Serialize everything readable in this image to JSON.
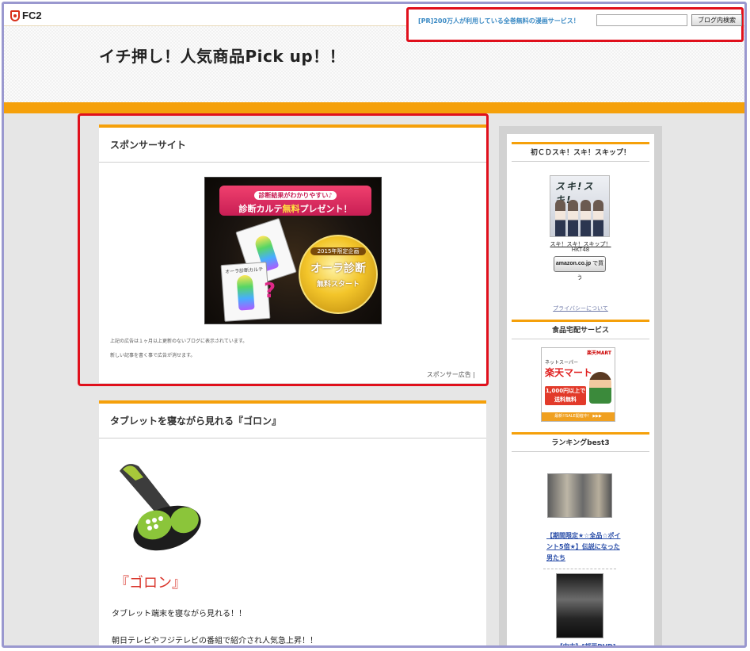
{
  "header": {
    "logo": "FC2",
    "pr_link": "[PR]200万人が利用している全巻無料の漫画サービス！",
    "search_placeholder": "",
    "search_button": "ブログ内検索",
    "blog_title": "イチ押し！人気商品Pick up！！"
  },
  "sponsor": {
    "title": "スポンサーサイト",
    "ad": {
      "top_line1": "診断結果がわかりやすい♪",
      "top_line2_a": "診断カルテ",
      "top_line2_b": "無料",
      "top_line2_c": "プレゼント！",
      "card_label": "オーラ診断カルテ",
      "badge_line1": "2015年限定企画",
      "badge_line2": "オーラ診断",
      "badge_line3": "無料スタート"
    },
    "note1": "上記の広告は１ヶ月以上更新のないブログに表示されています。",
    "note2": "新しい記事を書く事で広告が消せます。",
    "ad_link": "スポンサー広告 |"
  },
  "entry": {
    "title": "タブレットを寝ながら見れる『ゴロン』",
    "product_name": "『ゴロン』",
    "line1": "タブレット端末を寝ながら見れる！！",
    "line2": "朝日テレビやフジテレビの番組で紹介され人気急上昇！！"
  },
  "sidebar": {
    "cd": {
      "title": "初ＣＤスキ！スキ！スキップ！",
      "cover_text": "スキ!スキ!",
      "link": "スキ！スキ！スキップ！",
      "artist": "HKT48",
      "amazon_a": "amazon.co.jp",
      "amazon_b": "で買う",
      "privacy": "プライバシーについて"
    },
    "food": {
      "title": "食品宅配サービス",
      "banner_top": "楽天MART",
      "banner_sub": "ネットスーパー",
      "banner_main": "楽天マート",
      "banner_red1": "1,000円以上で",
      "banner_red2": "送料無料",
      "banner_bottom": "最新!!SALE開催中！ ▶▶▶"
    },
    "ranking": {
      "title": "ランキングbest3",
      "item1": "【期間限定★☆全品☆ポイント5倍★】伝説になった男たち",
      "item2": "【中古】[邦画DVD]"
    }
  }
}
